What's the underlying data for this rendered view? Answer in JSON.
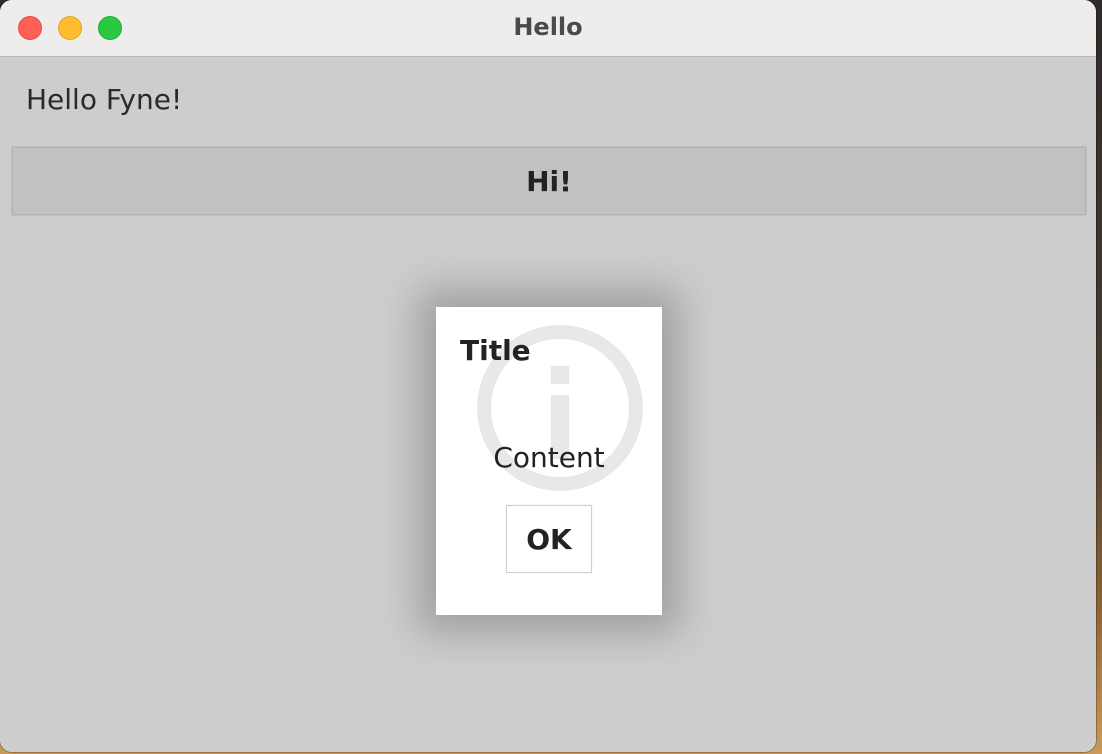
{
  "window": {
    "title": "Hello",
    "traffic_lights": {
      "close_color": "#fe5f57",
      "minimize_color": "#febc2e",
      "maximize_color": "#28c840"
    }
  },
  "main": {
    "label": "Hello Fyne!",
    "button_label": "Hi!"
  },
  "dialog": {
    "title": "Title",
    "content": "Content",
    "ok_label": "OK",
    "icon": "info-icon"
  },
  "colors": {
    "window_bg": "#cdcdcd",
    "button_bg": "#c1c1c1",
    "dialog_bg": "#ffffff"
  }
}
